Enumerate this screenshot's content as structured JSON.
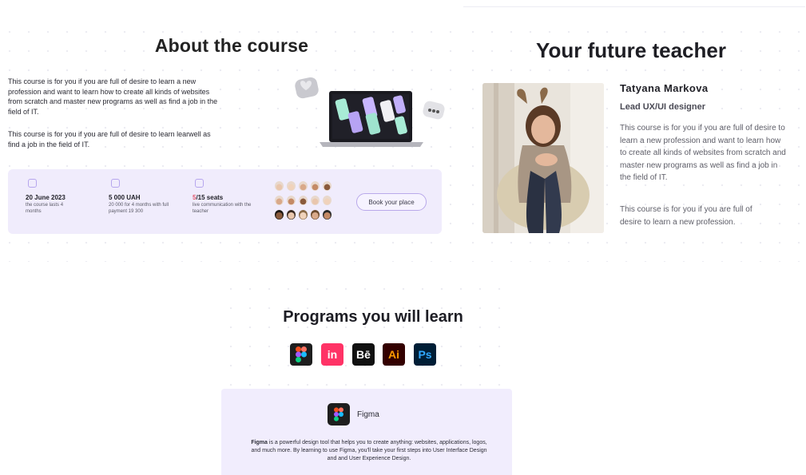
{
  "about": {
    "title": "About the course",
    "paragraph_1": "This course is for you if you are full of desire to learn a new profession and want to learn how to create all kinds of websites from scratch and master new programs as well as find a job in the field of IT.",
    "paragraph_2": "This course is for you if you are full of desire to learn learwell as find a job in the field of IT.",
    "info": {
      "date_title": "20 June 2023",
      "date_sub": "the course lasts 4 months",
      "price_title": "5 000 UAH",
      "price_sub": "20 000 for 4 months with full payment 19 300",
      "seats_taken": "5",
      "seats_rest": "/15 seats",
      "seats_sub": "live communication with the teacher",
      "book_label": "Book your place"
    }
  },
  "teacher": {
    "title": "Your future teacher",
    "name": "Tatyana Markova",
    "role": "Lead UX/UI designer",
    "paragraph_1": "This course is for you if you are full of desire to learn a new profession and want to learn how to create all kinds of websites from scratch and master new programs as well as find a job in the field of IT.",
    "paragraph_2": "This course is for you if you are full of desire to learn a new profession."
  },
  "programs": {
    "title": "Programs you will learn",
    "icons": [
      {
        "name": "figma",
        "label": "",
        "bg": "#1e1e1e",
        "color": "#ffffff"
      },
      {
        "name": "invision",
        "label": "in",
        "bg": "#ff3366",
        "color": "#ffffff"
      },
      {
        "name": "behance",
        "label": "Bē",
        "bg": "#111111",
        "color": "#ffffff"
      },
      {
        "name": "illustrator",
        "label": "Ai",
        "bg": "#330000",
        "color": "#ff9a00"
      },
      {
        "name": "photoshop",
        "label": "Ps",
        "bg": "#001e36",
        "color": "#31a8ff"
      }
    ],
    "card": {
      "name": "Figma",
      "desc_lead": "Figma",
      "desc_rest": " is a powerful design tool that helps you to create anything: websites, applications, logos, and much more. By learning to use Figma, you'll take your first steps into User Interface Design and and User Experience Design."
    }
  },
  "colors": {
    "accent_lavender": "#f0ecfc",
    "seat_accent": "#e0566a"
  }
}
